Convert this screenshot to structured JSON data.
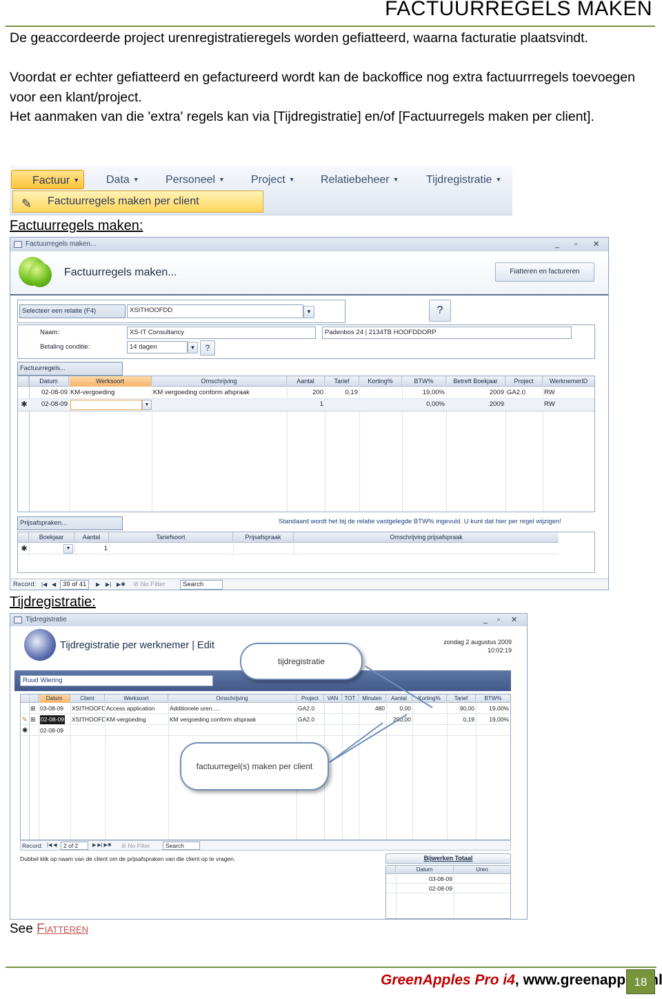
{
  "page": {
    "title": "FACTUURREGELS MAKEN",
    "intro": "De geaccordeerde project urenregistratieregels worden gefiatteerd, waarna facturatie plaatsvindt.",
    "para2": "Voordat er echter gefiatteerd en gefactureerd wordt kan de backoffice nog extra factuurrregels toevoegen voor een klant/project.",
    "para3": "Het aanmaken van die 'extra' regels kan via [Tijdregistratie] en/of [Factuurregels maken per client].",
    "section1": "Factuurregels maken:",
    "section2": "Tijdregistratie:",
    "see_prefix": "See ",
    "see_link": "Fiatteren"
  },
  "ribbon": {
    "tabs": [
      "Factuur",
      "Data",
      "Personeel",
      "Project",
      "Relatiebeheer",
      "Tijdregistratie"
    ],
    "dropdown_item": "Factuurregels maken per client"
  },
  "form1": {
    "window_title": "Factuurregels maken...",
    "heading": "Factuurregels maken...",
    "action_button": "Fiatteren en factureren",
    "relation_label": "Selecteer een relatie (F4)",
    "relation_value": "XSITHOOFDD",
    "name_label": "Naam:",
    "name_value": "XS-IT Consultancy",
    "address_value": "Padenbos 24 | 2134TB HOOFDDORP",
    "payment_label": "Betaling conditie:",
    "payment_value": "14 dagen",
    "lines_tab": "Factuurregels...",
    "columns": [
      "Datum",
      "Werksoort",
      "Omschrijving",
      "Aantal",
      "Tarief",
      "Korting%",
      "BTW%",
      "Betreft Boekjaar",
      "Project",
      "WerknemerID"
    ],
    "rows": [
      [
        "02-08-09",
        "KM-vergoeding",
        "KM vergoeding conform afspraak",
        "200",
        "0,19",
        "",
        "19,00%",
        "2009",
        "GA2.0",
        "RW"
      ],
      [
        "02-08-09",
        "",
        "",
        "1",
        "",
        "",
        "0,00%",
        "2009",
        "",
        "RW"
      ]
    ],
    "price_tab": "Prijsafspraken...",
    "price_note": "Standaard wordt het bij de relatie vastgelegde BTW% ingevuld. U kunt dat hier per regel wijzigen!",
    "price_columns": [
      "Boekjaar",
      "Aantal",
      "Tariefsoort",
      "Prijsafspraak",
      "Omschrijving prijsafspraak"
    ],
    "price_row": [
      "",
      "1",
      "",
      "",
      ""
    ],
    "record_label": "Record:",
    "record_value": "39 of 41",
    "nofilter": "No Filter",
    "search": "Search"
  },
  "form2": {
    "window_title": "Tijdregistratie",
    "heading": "Tijdregistratie per werknemer | Edit",
    "date": "zondag 2 augustus 2009",
    "time": "10:02:19",
    "employee": "Ruud  Wiering",
    "columns": [
      "Datum",
      "Client",
      "Werksoort",
      "Omschrijving",
      "Project",
      "VAN",
      "TOT",
      "Minuten",
      "Aantal",
      "Korting%",
      "Tarief",
      "BTW%"
    ],
    "rows": [
      [
        "03-08-09",
        "XSITHOOFDI",
        "Access application",
        "Additionele uren.....",
        "GA2.0",
        "",
        "",
        "480",
        "0,00",
        "",
        "90,00",
        "19,00%"
      ],
      [
        "02-08-09",
        "XSITHOOFDI",
        "KM-vergoeding",
        "KM vergoeding conform afspraak",
        "GA2.0",
        "",
        "",
        "",
        "200,00",
        "",
        "0,19",
        "19,00%"
      ],
      [
        "02-08-09",
        "",
        "",
        "",
        "",
        "",
        "",
        "",
        "",
        "",
        "",
        ""
      ]
    ],
    "callout1": "tijdregistratie",
    "callout2": "factuurregel(s) maken per client",
    "record_label": "Record:",
    "record_value": "2 of 2",
    "nofilter": "No Filter",
    "search": "Search",
    "hint": "Dubbel klik op naam van de client om de prijsafspraken van die client op te vragen.",
    "totals_button": "Bijwerken Totaal",
    "totals_columns": [
      "Datum",
      "Uren"
    ],
    "totals_rows": [
      [
        "03-08-09",
        ""
      ],
      [
        "02-08-09",
        ""
      ]
    ]
  },
  "footer": {
    "brand_name": "GreenApples Pro i4",
    "brand_site": ", www.greenapples.nl",
    "page_number": "18"
  },
  "colors": {
    "accent_green": "#77933c",
    "brand_red": "#c00000",
    "link_red": "#c0504d"
  }
}
